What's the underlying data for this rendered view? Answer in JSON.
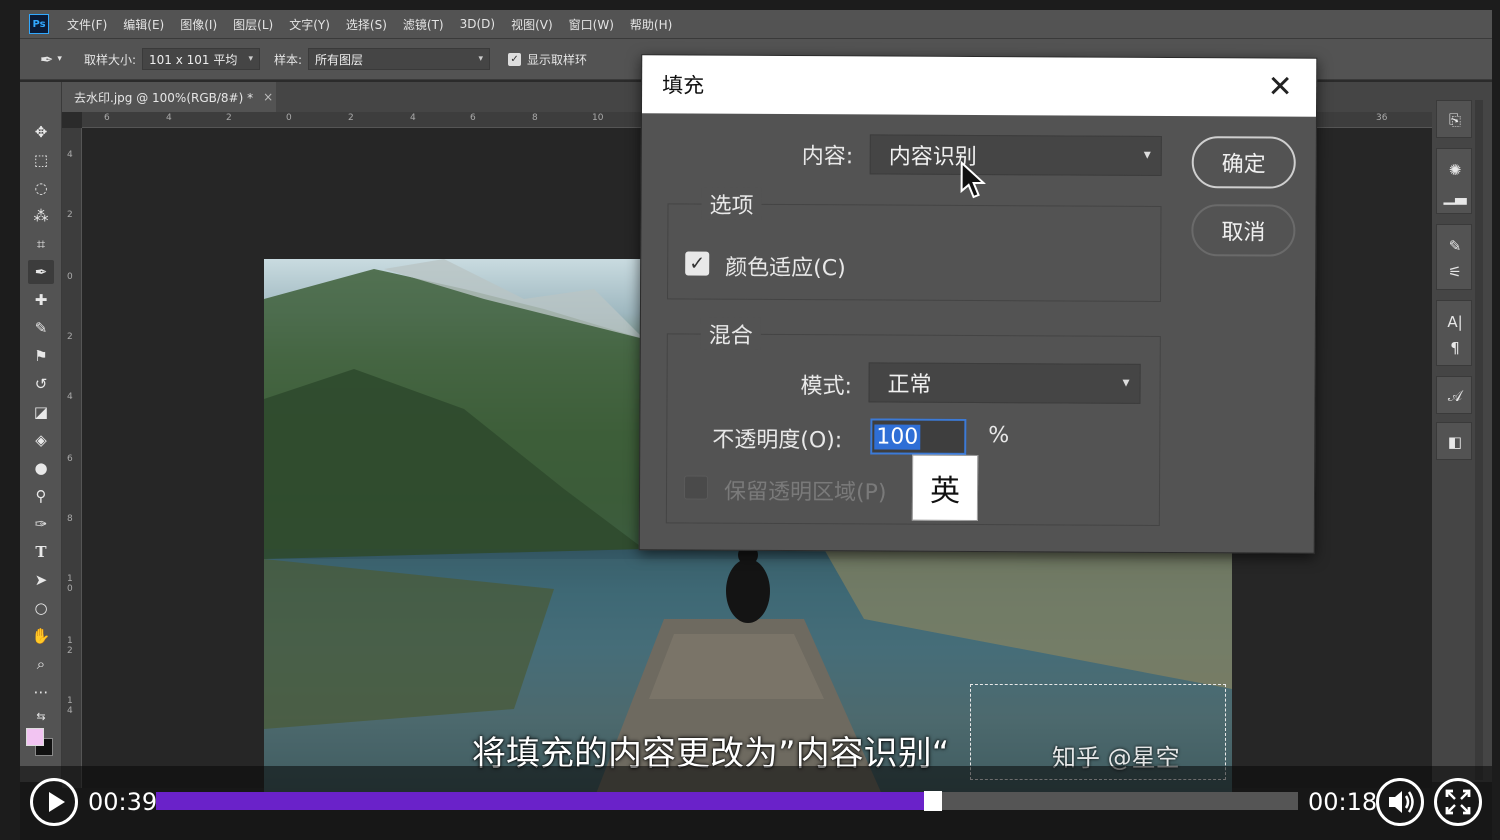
{
  "menubar": {
    "logo": "Ps",
    "items": [
      "文件(F)",
      "编辑(E)",
      "图像(I)",
      "图层(L)",
      "文字(Y)",
      "选择(S)",
      "滤镜(T)",
      "3D(D)",
      "视图(V)",
      "窗口(W)",
      "帮助(H)"
    ]
  },
  "options": {
    "sample_size_label": "取样大小:",
    "sample_size_value": "101 x 101 平均",
    "sample_label": "样本:",
    "sample_value": "所有图层",
    "show_ring_label": "显示取样环"
  },
  "document_tab": {
    "title": "去水印.jpg @ 100%(RGB/8#) *",
    "close": "×"
  },
  "rulers": {
    "top_ticks": [
      "6",
      "4",
      "2",
      "0",
      "2",
      "4",
      "6",
      "8",
      "10",
      "36"
    ],
    "left_ticks": [
      "4",
      "2",
      "0",
      "2",
      "4",
      "6",
      "8",
      "1 0",
      "1 2",
      "1 4"
    ]
  },
  "colors": {
    "foreground": "#f2c4f2",
    "background": "#111111",
    "accent_progress": "#6a22c9",
    "dialog_focus": "#3c7ad6"
  },
  "dialog": {
    "title": "填充",
    "content_label": "内容:",
    "content_value": "内容识别",
    "options_legend": "选项",
    "color_adapt_label": "颜色适应(C)",
    "color_adapt_checked": true,
    "blend_legend": "混合",
    "mode_label": "模式:",
    "mode_value": "正常",
    "opacity_label": "不透明度(O):",
    "opacity_value": "100",
    "opacity_unit": "%",
    "preserve_label": "保留透明区域(P)",
    "preserve_checked": false,
    "ok_label": "确定",
    "cancel_label": "取消",
    "ime_indicator": "英"
  },
  "subtitle": {
    "text": "将填充的内容更改为”内容识别“",
    "watermark": "知乎 @星空"
  },
  "player": {
    "current_time": "00:39",
    "remaining_time": "00:18",
    "progress": 0.68
  }
}
